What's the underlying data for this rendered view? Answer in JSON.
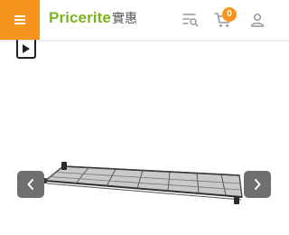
{
  "header": {
    "menu_icon": "hamburger-menu-icon",
    "brand_color": "#f7941d",
    "logo": {
      "latin": "Pricerite",
      "chinese": "實惠",
      "latin_color": "#7ab51d"
    },
    "filter_icon": "search-filter-icon",
    "cart": {
      "icon": "cart-icon",
      "count": "0"
    },
    "account_icon": "user-icon"
  },
  "gallery": {
    "video_icon": "play-icon",
    "product_image": "wire-shelf",
    "prev_icon": "chevron-left-icon",
    "next_icon": "chevron-right-icon",
    "arrow_color": "#6f6f6f"
  }
}
